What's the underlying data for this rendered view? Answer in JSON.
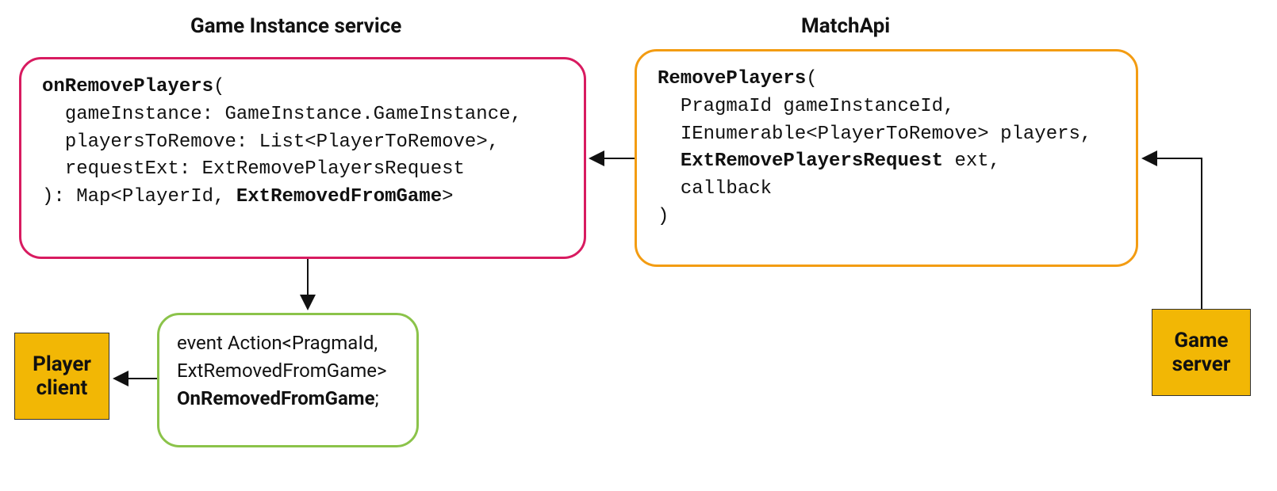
{
  "titles": {
    "gis": "Game Instance service",
    "matchapi": "MatchApi"
  },
  "pink": {
    "fn": "onRemovePlayers",
    "p1_name": "gameInstance",
    "p1_type": "GameInstance.GameInstance",
    "p2_name": "playersToRemove",
    "p2_type": "List<PlayerToRemove>",
    "p3_name": "requestExt",
    "p3_type": "ExtRemovePlayersRequest",
    "ret_prefix": "Map<PlayerId, ",
    "ret_bold": "ExtRemovedFromGame",
    "ret_suffix": ">"
  },
  "orange": {
    "fn": "RemovePlayers",
    "p1": "PragmaId gameInstanceId",
    "p2": "IEnumerable<PlayerToRemove> players",
    "p3_bold": "ExtRemovePlayersRequest",
    "p3_rest": " ext",
    "p4": "callback"
  },
  "green": {
    "l1": "event Action<PragmaId,",
    "l2": "ExtRemovedFromGame>",
    "l3_bold": "OnRemovedFromGame",
    "l3_suffix": ";"
  },
  "squares": {
    "player_client": "Player client",
    "game_server": "Game server"
  }
}
